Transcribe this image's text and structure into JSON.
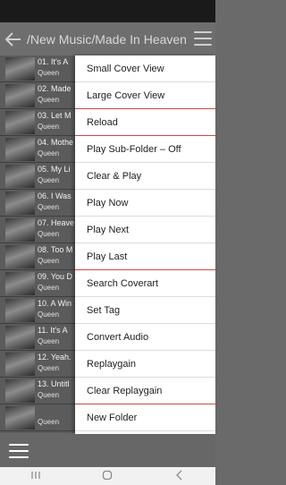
{
  "header": {
    "path": "/New Music/Made In Heaven"
  },
  "tracks": [
    {
      "title": "01. It's A",
      "artist": "Queen"
    },
    {
      "title": "02. Made",
      "artist": "Queen"
    },
    {
      "title": "03. Let M",
      "artist": "Queen"
    },
    {
      "title": "04. Mothe",
      "artist": "Queen"
    },
    {
      "title": "05. My Li",
      "artist": "Queen"
    },
    {
      "title": "06. I Was",
      "artist": "Queen"
    },
    {
      "title": "07. Heave",
      "artist": "Queen"
    },
    {
      "title": "08. Too M",
      "artist": "Queen"
    },
    {
      "title": "09. You D",
      "artist": "Queen"
    },
    {
      "title": "10. A Win",
      "artist": "Queen"
    },
    {
      "title": "11. It's A",
      "artist": "Queen"
    },
    {
      "title": "12. Yeah.",
      "artist": "Queen"
    },
    {
      "title": "13. Untitl",
      "artist": "Queen"
    },
    {
      "title": "",
      "artist": "Queen"
    }
  ],
  "menu": {
    "items": [
      "Small Cover View",
      "Large Cover View",
      "Reload",
      "Play Sub-Folder – Off",
      "Clear & Play",
      "Play Now",
      "Play Next",
      "Play Last",
      "Search Coverart",
      "Set Tag",
      "Convert Audio",
      "Replaygain",
      "Clear Replaygain",
      "New Folder"
    ]
  },
  "icons": {
    "back": "arrow-left-icon",
    "menu_top": "hamburger-icon",
    "menu_bottom": "hamburger-icon",
    "nav_recent": "recent-apps-icon",
    "nav_home": "home-icon",
    "nav_back": "chevron-left-icon"
  },
  "colors": {
    "menu_background": "#ffffff",
    "menu_highlight_divider": "#d04848",
    "topbar": "#6e6e6e",
    "list_background": "#5b5b5b"
  }
}
